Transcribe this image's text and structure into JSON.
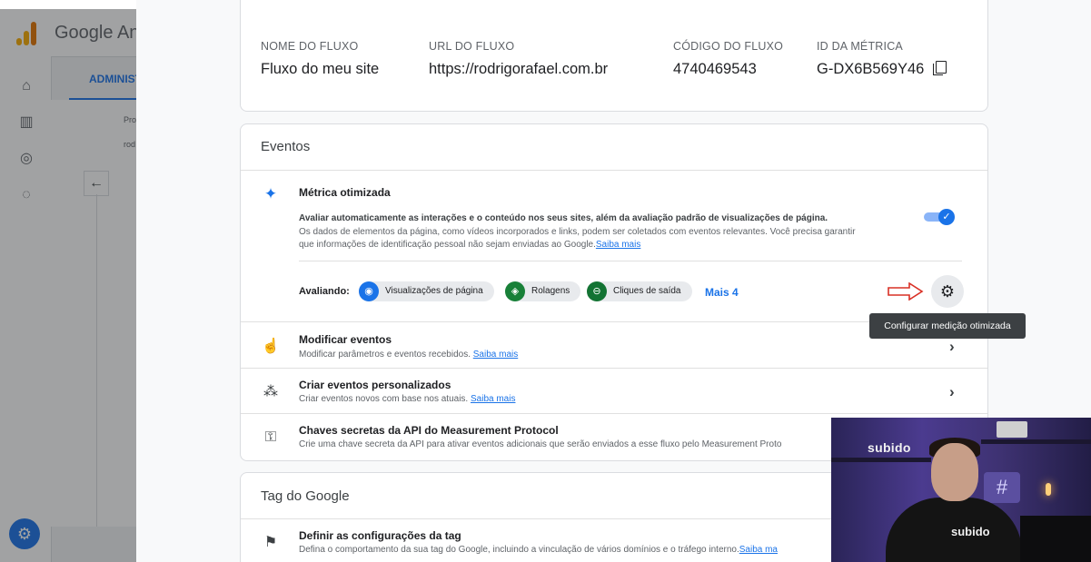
{
  "background": {
    "app_title": "Google An",
    "admin_tab": "ADMINIST",
    "panel_text_1": "Pro",
    "panel_text_2": "rod"
  },
  "stream": {
    "name_label": "NOME DO FLUXO",
    "name_value": "Fluxo do meu site",
    "url_label": "URL DO FLUXO",
    "url_value": "https://rodrigorafael.com.br",
    "code_label": "CÓDIGO DO FLUXO",
    "code_value": "4740469543",
    "metric_label": "ID DA MÉTRICA",
    "metric_value": "G-DX6B569Y46"
  },
  "events": {
    "title": "Eventos",
    "enhanced": {
      "title": "Métrica otimizada",
      "line1": "Avaliar automaticamente as interações e o conteúdo nos seus sites, além da avaliação padrão de visualizações de página.",
      "line2": "Os dados de elementos da página, como vídeos incorporados e links, podem ser coletados com eventos relevantes. Você precisa garantir",
      "line3": "que informações de identificação pessoal não sejam enviadas ao Google.",
      "link": "Saiba mais",
      "toggle_on": true,
      "measuring_label": "Avaliando:",
      "chips": [
        "Visualizações de página",
        "Rolagens",
        "Cliques de saída"
      ],
      "more": "Mais 4"
    },
    "tooltip": "Configurar medição otimizada",
    "modify": {
      "title": "Modificar eventos",
      "desc": "Modificar parâmetros e eventos recebidos.",
      "link": "Saiba mais"
    },
    "create": {
      "title": "Criar eventos personalizados",
      "desc": "Criar eventos novos com base nos atuais.",
      "link": "Saiba mais"
    },
    "secrets": {
      "title": "Chaves secretas da API do Measurement Protocol",
      "desc": "Crie uma chave secreta da API para ativar eventos adicionais que serão enviados a esse fluxo pelo Measurement Proto"
    }
  },
  "tag": {
    "title": "Tag do Google",
    "config_title": "Definir as configurações da tag",
    "config_desc": "Defina o comportamento da sua tag do Google, incluindo a vinculação de vários domínios e o tráfego interno.",
    "config_link": "Saiba ma"
  },
  "webcam": {
    "wall_text": "subido",
    "shirt_text": "subido"
  }
}
